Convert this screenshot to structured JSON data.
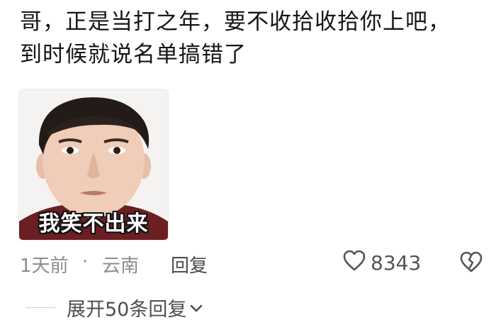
{
  "comment": {
    "text_line1": "哥，正是当打之年，要不收拾收拾你上吧，",
    "text_line2": "到时候就说名单搞错了"
  },
  "meme": {
    "caption": "我笑不出来"
  },
  "meta": {
    "time": "1天前",
    "separator": "·",
    "location": "云南",
    "reply_label": "回复",
    "like_count": "8343"
  },
  "expand": {
    "label": "展开50条回复"
  },
  "icons": {
    "like": "heart-outline-icon",
    "dislike": "broken-heart-icon",
    "expand": "chevron-down-icon"
  },
  "colors": {
    "text": "#161616",
    "muted": "#8c8c8c",
    "icon": "#555555"
  }
}
